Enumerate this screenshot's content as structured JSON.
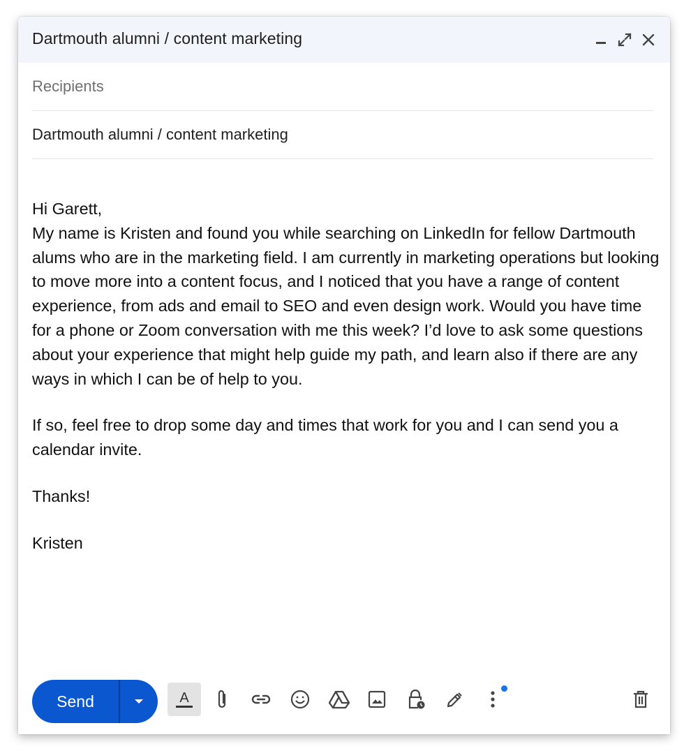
{
  "window": {
    "title": "Dartmouth alumni / content marketing",
    "controls": [
      "minimize-icon",
      "expand-icon",
      "close-icon"
    ]
  },
  "fields": {
    "recipients_placeholder": "Recipients",
    "subject": "Dartmouth alumni / content marketing"
  },
  "body": {
    "greeting": "Hi Garett,",
    "paragraph1": "My name is Kristen and found you while searching on LinkedIn for fellow Dartmouth alums who are in the marketing field. I am currently in marketing operations but looking to move more into a content focus, and I noticed that you have a range of content experience, from ads and email to SEO and even design work. Would you have time for a phone or Zoom conversation with me this week? I’d love to ask some questions about your experience that might help guide my path, and learn also if there are any ways in which I can be of help to you.",
    "paragraph2": "If so, feel free to drop some day and times that work for you and I can send you a calendar invite.",
    "closing": "Thanks!",
    "signature": "Kristen"
  },
  "toolbar": {
    "send_label": "Send",
    "accent_color": "#0b57d0",
    "tools": [
      "formatting-icon",
      "attach-icon",
      "link-icon",
      "emoji-icon",
      "drive-icon",
      "photo-icon",
      "confidential-icon",
      "signature-icon",
      "more-options-icon",
      "trash-icon"
    ]
  }
}
